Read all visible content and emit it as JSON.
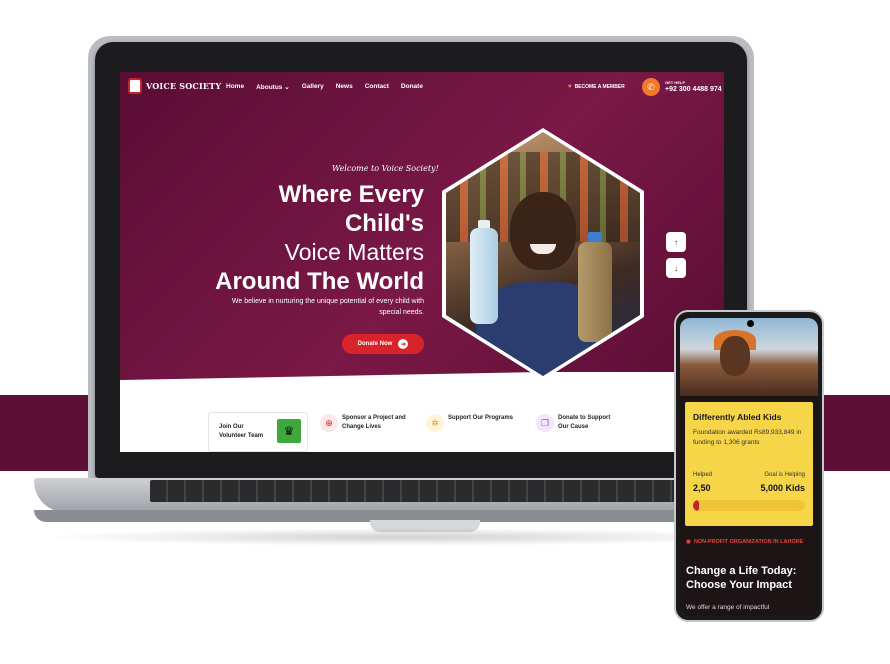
{
  "colors": {
    "brand": "#5e0f36",
    "accent_red": "#d8232a",
    "accent_orange": "#f07a2a",
    "card_yellow": "#f7d548"
  },
  "nav": {
    "logo_text": "VOICE SOCIETY",
    "links": [
      "Home",
      "Aboutus",
      "Gallery",
      "News",
      "Contact",
      "Donate"
    ],
    "member_label": "BECOME A MEMBER",
    "help_label": "GET HELP",
    "phone_number": "+92 300 4488 974",
    "icons": {
      "member": "heart-icon",
      "phone": "phone-icon",
      "dropdown": "chevron-down-icon"
    }
  },
  "hero": {
    "welcome": "Welcome to Voice Society!",
    "line1": "Where Every",
    "line2": "Child's",
    "line3": "Voice Matters",
    "line4": "Around The World",
    "subtitle": "We believe in nurturing the unique potential of every child with special needs.",
    "cta_label": "Donate Now",
    "scroll_up": "↑",
    "scroll_down": "↓"
  },
  "features": [
    {
      "label": "Join Our Volunteer Team",
      "icon": "crown-icon"
    },
    {
      "label": "Sponsor a Project and Change Lives",
      "icon": "globe-hands-icon"
    },
    {
      "label": "Support Our Programs",
      "icon": "handshake-icon"
    },
    {
      "label": "Donate to Support Our Cause",
      "icon": "gift-box-icon"
    }
  ],
  "mobile": {
    "card_title": "Differently Abled Kids",
    "card_desc": "Foundation awarded Rs89,933,849 in funding to 1,306 grants",
    "helped_label": "Helped",
    "helped_value": "2,50",
    "goal_label": "Goal is Helping",
    "goal_value": "5,000 Kids",
    "progress_fraction": 0.05,
    "org_label": "NON-PROFIT ORGANIZATION IN LAHORE",
    "headline": "Change a Life Today: Choose Your Impact",
    "body_text": "We offer a range of impactful"
  }
}
